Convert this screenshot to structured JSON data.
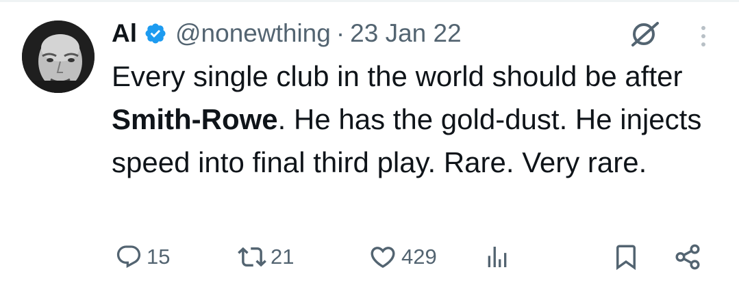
{
  "tweet": {
    "author": {
      "display_name": "Al",
      "verified": true,
      "handle": "@nonewthing"
    },
    "separator": "·",
    "date": "23 Jan 22",
    "text": {
      "before_bold": "Every single club in the world should be after ",
      "bold": "Smith-Rowe",
      "after_bold": ". He has the gold-dust. He injects speed into final third play. Rare. Very rare."
    },
    "stats": {
      "replies": "15",
      "retweets": "21",
      "likes": "429"
    }
  },
  "icons": {
    "verified": "verified-badge-icon",
    "grok": "grok-icon",
    "more": "more-vertical-icon",
    "reply": "reply-icon",
    "retweet": "retweet-icon",
    "like": "heart-icon",
    "views": "views-icon",
    "bookmark": "bookmark-icon",
    "share": "share-icon"
  },
  "colors": {
    "text_primary": "#0f1419",
    "text_secondary": "#536471",
    "verified_blue": "#1d9bf0",
    "divider": "#eff3f4"
  }
}
